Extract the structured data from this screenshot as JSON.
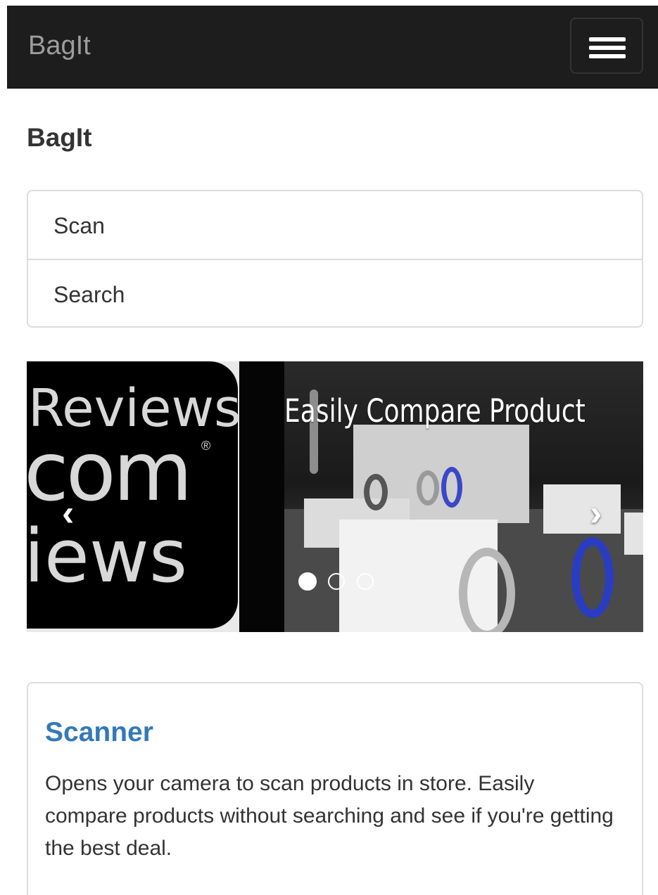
{
  "navbar": {
    "brand": "BagIt",
    "toggle_icon": "hamburger-icon"
  },
  "page": {
    "heading": "BagIt"
  },
  "menu": {
    "items": [
      {
        "label": "Scan"
      },
      {
        "label": "Search"
      }
    ]
  },
  "carousel": {
    "left_slide_logo": {
      "line1": "Reviews",
      "line2": "com",
      "line3": "iews",
      "mark": "®"
    },
    "caption": "Easily Compare Product",
    "prev_icon": "chevron-left-icon",
    "next_icon": "chevron-right-icon",
    "indicator_count": 3,
    "active_indicator": 0
  },
  "panel": {
    "title": "Scanner",
    "description": "Opens your camera to scan products in store. Easily compare products without searching and see if you're getting the best deal."
  },
  "colors": {
    "navbar_bg": "#1d1d1d",
    "brand_text": "#9d9d9d",
    "link_blue": "#337ab7",
    "border": "#dddddd"
  }
}
